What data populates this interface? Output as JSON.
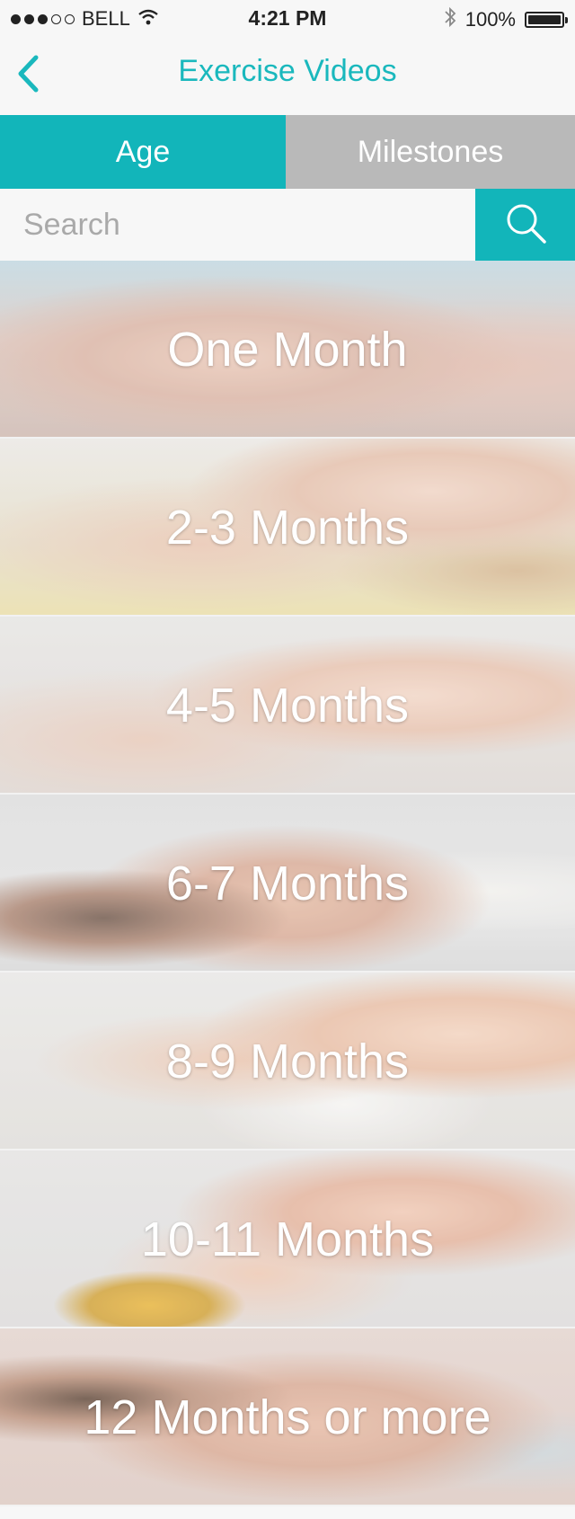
{
  "status_bar": {
    "carrier": "BELL",
    "time": "4:21 PM",
    "battery_text": "100%",
    "signal_filled": 3,
    "signal_total": 5
  },
  "nav": {
    "title": "Exercise Videos",
    "back_icon": "chevron-left-icon"
  },
  "tabs": [
    {
      "label": "Age",
      "active": true
    },
    {
      "label": "Milestones",
      "active": false
    }
  ],
  "search": {
    "placeholder": "Search",
    "value": "",
    "icon": "search-icon"
  },
  "age_groups": [
    {
      "label": "One Month"
    },
    {
      "label": "2-3 Months"
    },
    {
      "label": "4-5 Months"
    },
    {
      "label": "6-7 Months"
    },
    {
      "label": "8-9 Months"
    },
    {
      "label": "10-11 Months"
    },
    {
      "label": "12 Months or more"
    }
  ],
  "colors": {
    "accent": "#12b5ba",
    "title": "#1ab8bd",
    "inactive_tab": "#b9b9b9"
  }
}
